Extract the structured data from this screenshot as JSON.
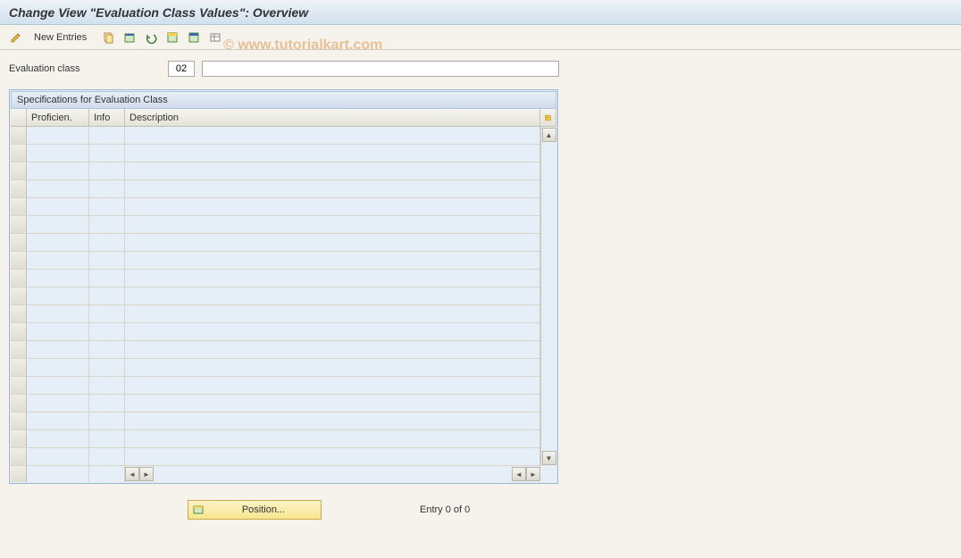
{
  "title": "Change View \"Evaluation Class Values\": Overview",
  "toolbar": {
    "new_entries_label": "New Entries"
  },
  "form": {
    "evaluation_class_label": "Evaluation class",
    "evaluation_class_value": "02",
    "evaluation_class_desc": ""
  },
  "grid": {
    "panel_title": "Specifications for Evaluation Class",
    "columns": {
      "proficien": "Proficien.",
      "info": "Info",
      "description": "Description"
    },
    "rows": []
  },
  "footer": {
    "position_label": "Position...",
    "entry_text": "Entry 0 of 0"
  },
  "watermark": "© www.tutorialkart.com"
}
